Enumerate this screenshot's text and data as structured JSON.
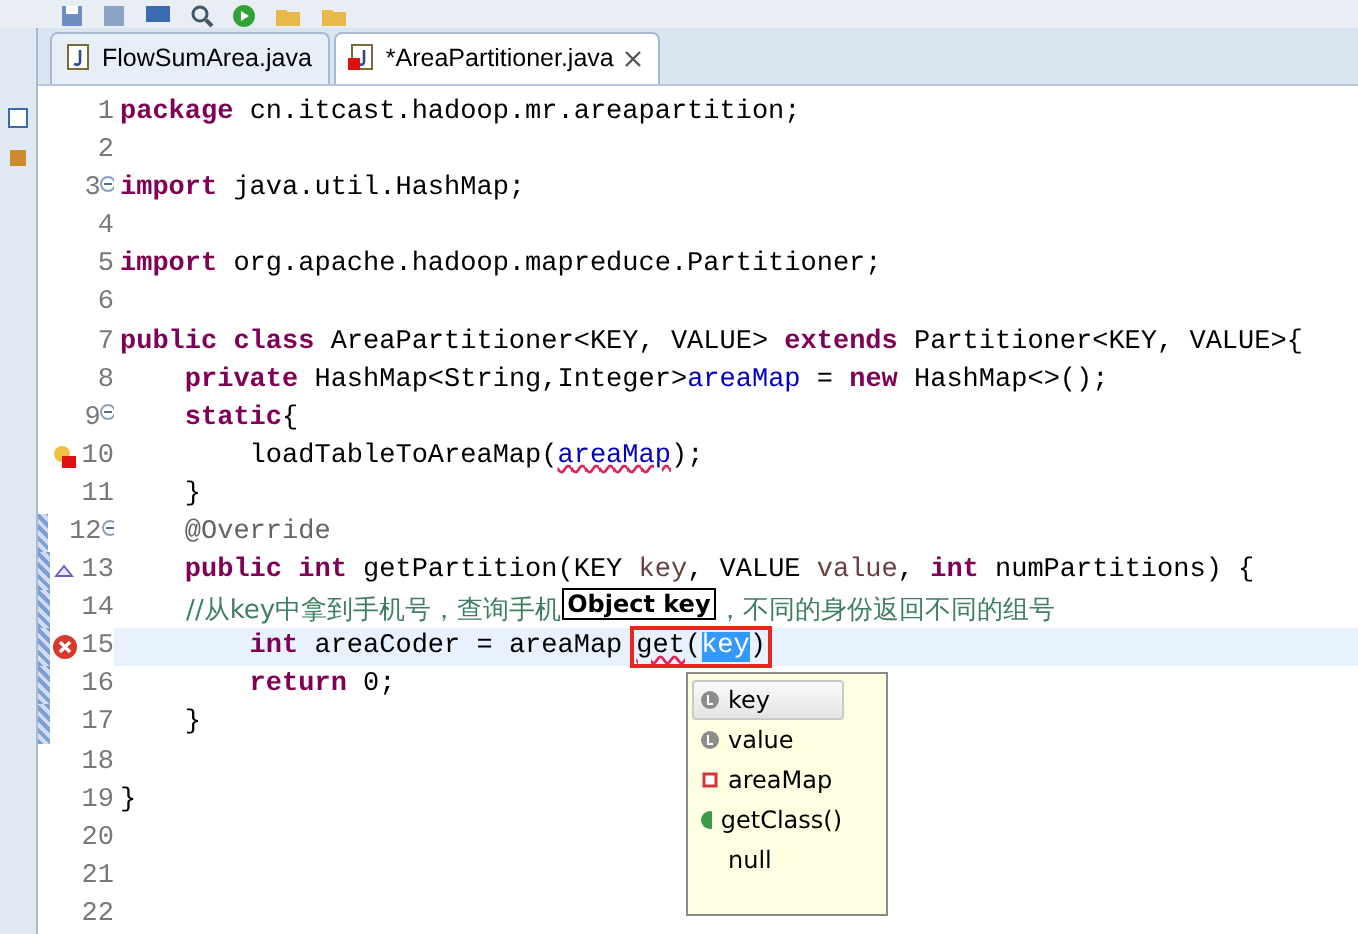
{
  "tabs": [
    {
      "label": "FlowSumArea.java",
      "selected": false,
      "error": false
    },
    {
      "label": "*AreaPartitioner.java",
      "selected": true,
      "error": true
    }
  ],
  "editor": {
    "lines": [
      {
        "number": "1",
        "fold": false,
        "changed": false,
        "current": false,
        "tokens": [
          {
            "text": "package",
            "kind": "keyword"
          },
          {
            "text": " cn.itcast.hadoop.mr.areapartition;",
            "kind": "plain"
          }
        ]
      },
      {
        "number": "2",
        "fold": false,
        "changed": false,
        "current": false
      },
      {
        "number": "3",
        "fold": true,
        "changed": false,
        "current": false,
        "tokens": [
          {
            "text": "import",
            "kind": "keyword"
          },
          {
            "text": " java.util.HashMap;",
            "kind": "plain"
          }
        ]
      },
      {
        "number": "4",
        "fold": false,
        "changed": false,
        "current": false
      },
      {
        "number": "5",
        "fold": false,
        "changed": false,
        "current": false,
        "tokens": [
          {
            "text": "import",
            "kind": "keyword"
          },
          {
            "text": " org.apache.hadoop.mapreduce.Partitioner;",
            "kind": "plain"
          }
        ]
      },
      {
        "number": "6",
        "fold": false,
        "changed": false,
        "current": false
      },
      {
        "number": "7",
        "fold": false,
        "changed": false,
        "current": false,
        "tokens": [
          {
            "text": "public class",
            "kind": "keyword"
          },
          {
            "text": " AreaPartitioner<KEY, VALUE> ",
            "kind": "plain"
          },
          {
            "text": "extends",
            "kind": "keyword"
          },
          {
            "text": " Partitioner<KEY, VALUE>{",
            "kind": "plain"
          }
        ]
      },
      {
        "number": "8",
        "fold": false,
        "changed": false,
        "current": false,
        "tokens": [
          {
            "text": "    private",
            "kind": "keyword"
          },
          {
            "text": " HashMap<String,Integer>",
            "kind": "plain"
          },
          {
            "text": "areaMap",
            "kind": "field"
          },
          {
            "text": " = ",
            "kind": "plain"
          },
          {
            "text": "new",
            "kind": "keyword"
          },
          {
            "text": " HashMap<>();",
            "kind": "plain"
          }
        ]
      },
      {
        "number": "9",
        "fold": true,
        "changed": false,
        "current": false,
        "tokens": [
          {
            "text": "    static",
            "kind": "keyword"
          },
          {
            "text": "{",
            "kind": "plain"
          }
        ]
      },
      {
        "number": "10",
        "kind": "warning-error",
        "fold": false,
        "changed": false,
        "current": false,
        "tokens": [
          {
            "text": "        loadTableToAreaMap(",
            "kind": "plain"
          },
          {
            "text": "areaMap",
            "kind": "field-error"
          },
          {
            "text": ");",
            "kind": "plain"
          }
        ]
      },
      {
        "number": "11",
        "fold": false,
        "changed": false,
        "current": false,
        "tokens": [
          {
            "text": "    }",
            "kind": "plain"
          }
        ]
      },
      {
        "number": "12",
        "fold": true,
        "changed": true,
        "current": false,
        "tokens": [
          {
            "text": "    @Override",
            "kind": "annotation"
          }
        ]
      },
      {
        "number": "13",
        "kind": "override",
        "fold": false,
        "changed": true,
        "current": false,
        "tokens": [
          {
            "text": "    public int",
            "kind": "keyword"
          },
          {
            "text": " getPartition(KEY ",
            "kind": "plain"
          },
          {
            "text": "key",
            "kind": "param"
          },
          {
            "text": ", VALUE ",
            "kind": "plain"
          },
          {
            "text": "value",
            "kind": "param"
          },
          {
            "text": ", ",
            "kind": "plain"
          },
          {
            "text": "int",
            "kind": "keyword"
          },
          {
            "text": " numPartitions) {",
            "kind": "plain"
          }
        ]
      },
      {
        "number": "14",
        "fold": false,
        "changed": true,
        "current": false,
        "tokens": [
          {
            "text": "        //从key中拿到手机号，查询手机",
            "kind": "comment"
          },
          {
            "text": "Object key",
            "kind": "tooltip"
          },
          {
            "text": "，不同的身份返回不同的组号",
            "kind": "comment"
          }
        ]
      },
      {
        "number": "15",
        "kind": "error",
        "fold": false,
        "changed": true,
        "current": true,
        "tokens": [
          {
            "text": "        int",
            "kind": "keyword"
          },
          {
            "text": " areaCoder = areaMap",
            "kind": "plain"
          },
          {
            "text": "get",
            "kind": "error",
            "boxed": true
          },
          {
            "text": "(",
            "kind": "plain",
            "boxed": true
          },
          {
            "text": "key",
            "kind": "selected",
            "boxed": true
          },
          {
            "text": ")",
            "kind": "plain",
            "boxed": true
          }
        ]
      },
      {
        "number": "16",
        "fold": false,
        "changed": true,
        "current": false,
        "tokens": [
          {
            "text": "        return",
            "kind": "keyword"
          },
          {
            "text": " 0;",
            "kind": "plain"
          }
        ]
      },
      {
        "number": "17",
        "fold": false,
        "changed": true,
        "current": false,
        "tokens": [
          {
            "text": "    }",
            "kind": "plain"
          }
        ]
      },
      {
        "number": "18",
        "fold": false,
        "changed": false,
        "current": false
      },
      {
        "number": "19",
        "fold": false,
        "changed": false,
        "current": false,
        "tokens": [
          {
            "text": "}",
            "kind": "plain"
          }
        ]
      },
      {
        "number": "20",
        "fold": false,
        "changed": false,
        "current": false
      },
      {
        "number": "21",
        "fold": false,
        "changed": false,
        "current": false
      },
      {
        "number": "22",
        "fold": false,
        "changed": false,
        "current": false
      }
    ],
    "completion": {
      "items": [
        {
          "label": "key",
          "kind": "local",
          "selected": true
        },
        {
          "label": "value",
          "kind": "local",
          "selected": false
        },
        {
          "label": "areaMap",
          "kind": "field",
          "selected": false
        },
        {
          "label": "getClass()",
          "kind": "method",
          "selected": false
        },
        {
          "label": "null",
          "kind": "none",
          "selected": false
        }
      ]
    }
  }
}
